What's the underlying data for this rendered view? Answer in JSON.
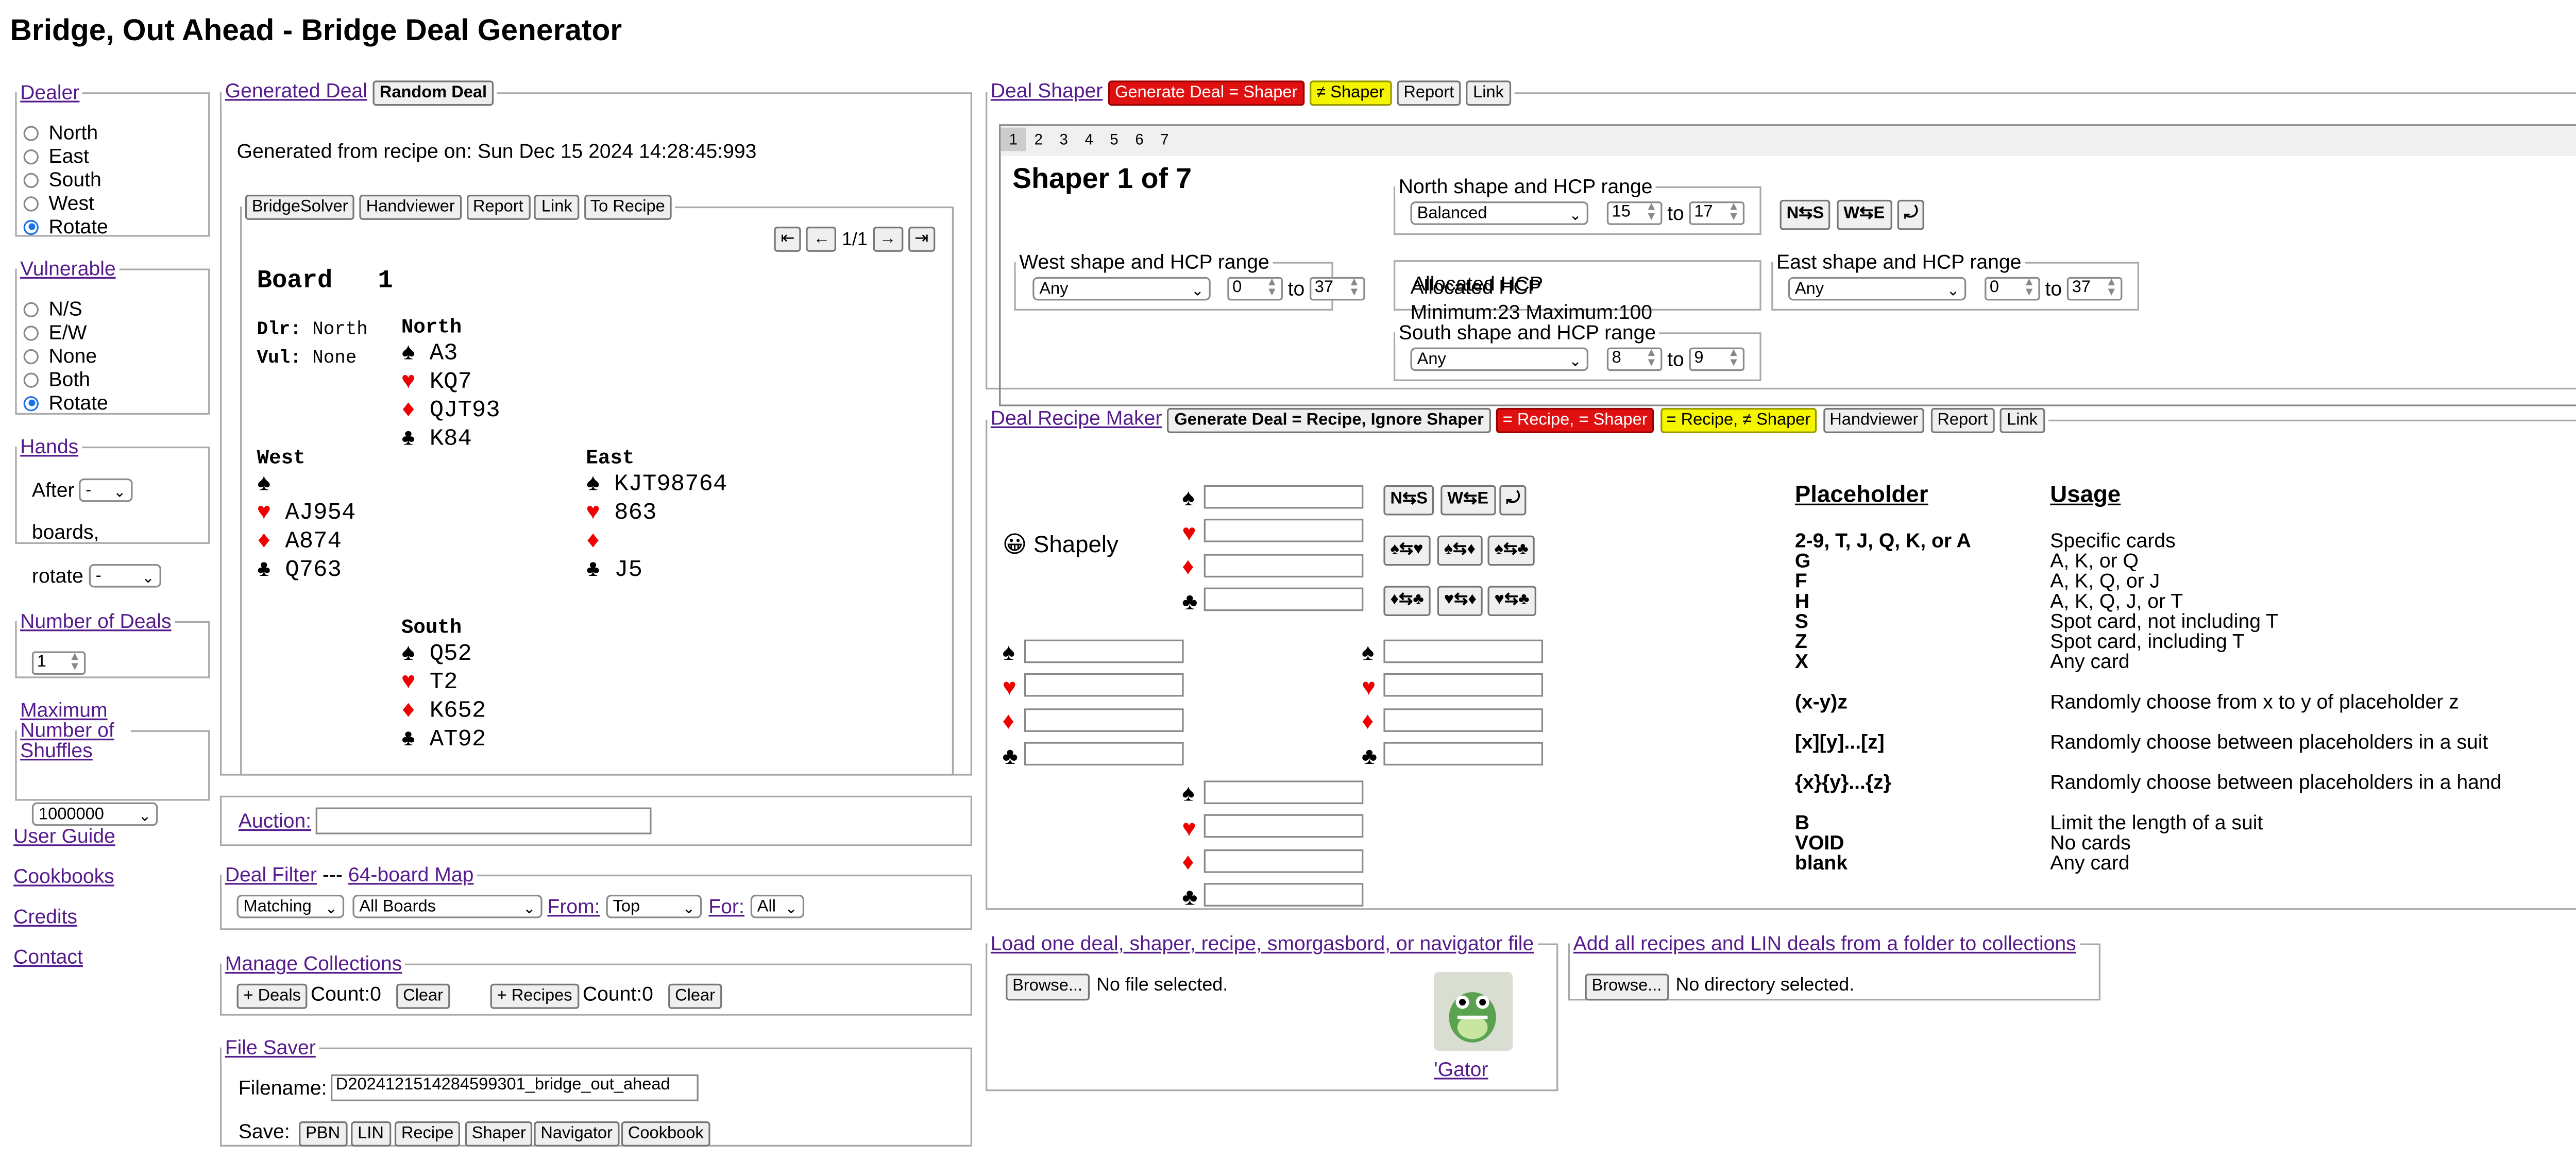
{
  "page_title": "Bridge, Out Ahead - Bridge Deal Generator",
  "dealer": {
    "legend": "Dealer",
    "options": [
      "North",
      "East",
      "South",
      "West",
      "Rotate"
    ],
    "selected": "Rotate"
  },
  "vulnerable": {
    "legend": "Vulnerable",
    "options": [
      "N/S",
      "E/W",
      "None",
      "Both",
      "Rotate"
    ],
    "selected": "Rotate"
  },
  "hands_box": {
    "legend": "Hands",
    "after_label": "After",
    "after_value": "-",
    "boards_label": "boards,",
    "rotate_label": "rotate",
    "rotate_value": "-"
  },
  "num_deals": {
    "legend": "Number of Deals",
    "value": "1"
  },
  "max_shuffles": {
    "legend": "Maximum Number of Shuffles",
    "value": "1000000"
  },
  "side_links": [
    "User Guide",
    "Cookbooks",
    "Credits",
    "Contact"
  ],
  "generated": {
    "legend": "Generated Deal",
    "random_btn": "Random Deal",
    "recipe_line": "Generated from recipe on: Sun Dec 15 2024 14:28:45:993",
    "buttons": [
      "BridgeSolver",
      "Handviewer",
      "Report",
      "Link",
      "To Recipe"
    ],
    "nav": {
      "first": "⇤",
      "prev": "←",
      "page": "1/1",
      "next": "→",
      "last": "⇥"
    },
    "board_label": "Board",
    "board_number": "1",
    "dlr_label": "Dlr:",
    "dlr_value": "North",
    "vul_label": "Vul:",
    "vul_value": "None",
    "north": {
      "name": "North",
      "s": "A3",
      "h": "KQ7",
      "d": "QJT93",
      "c": "K84"
    },
    "west": {
      "name": "West",
      "s": "",
      "h": "AJ954",
      "d": "A874",
      "c": "Q763"
    },
    "east": {
      "name": "East",
      "s": "KJT98764",
      "h": "863",
      "d": "",
      "c": "J5"
    },
    "south": {
      "name": "South",
      "s": "Q52",
      "h": "T2",
      "d": "K652",
      "c": "AT92"
    }
  },
  "auction": {
    "label": "Auction:",
    "value": ""
  },
  "deal_filter": {
    "legend": "Deal Filter",
    "sep": "---",
    "map_link": "64-board Map",
    "matching": "Matching",
    "boards": "All Boards",
    "from_label": "From:",
    "from_value": "Top",
    "for_label": "For:",
    "for_value": "All"
  },
  "collections": {
    "legend": "Manage Collections",
    "deals_btn": "+ Deals",
    "deals_count": "Count:0",
    "clear1": "Clear",
    "recipes_btn": "+ Recipes",
    "recipes_count": "Count:0",
    "clear2": "Clear"
  },
  "file_saver": {
    "legend": "File Saver",
    "filename_label": "Filename:",
    "filename_value": "D2024121514284599301_bridge_out_ahead",
    "save_label": "Save:",
    "buttons": [
      "PBN",
      "LIN",
      "Recipe",
      "Shaper",
      "Navigator",
      "Cookbook"
    ]
  },
  "shaper": {
    "legend": "Deal Shaper",
    "btn_gen": "Generate Deal = Shaper",
    "btn_ne": "≠ Shaper",
    "btn_report": "Report",
    "btn_link": "Link",
    "tabs": [
      "1",
      "2",
      "3",
      "4",
      "5",
      "6",
      "7"
    ],
    "heading": "Shaper 1 of 7",
    "north": {
      "legend": "North shape and HCP range",
      "shape": "Balanced",
      "min": "15",
      "to": "to",
      "max": "17"
    },
    "west": {
      "legend": "West shape and HCP range",
      "shape": "Any",
      "min": "0",
      "to": "to",
      "max": "37"
    },
    "east": {
      "legend": "East shape and HCP range",
      "shape": "Any",
      "min": "0",
      "to": "to",
      "max": "37"
    },
    "south": {
      "legend": "South shape and HCP range",
      "shape": "Any",
      "min": "8",
      "to": "to",
      "max": "9"
    },
    "alloc": {
      "legend": "Allocated HCP",
      "text": "Minimum:23 Maximum:100"
    },
    "swap_ns": "N⇆S",
    "swap_we": "W⇆E",
    "rotate": "⤾"
  },
  "recipe": {
    "legend": "Deal Recipe Maker",
    "btn_gen": "Generate Deal = Recipe, Ignore Shaper",
    "btn_eq_eq": "= Recipe, = Shaper",
    "btn_eq_ne": "= Recipe, ≠ Shaper",
    "btn_hv": "Handviewer",
    "btn_report": "Report",
    "btn_link": "Link",
    "shapely_emoji": "😀",
    "shapely_label": "Shapely",
    "swap_ns": "N⇆S",
    "swap_we": "W⇆E",
    "rotate": "⤾",
    "suit_swaps_1": [
      "♠⇆♥",
      "♠⇆♦",
      "♠⇆♣"
    ],
    "suit_swaps_2": [
      "♦⇆♣",
      "♥⇆♦",
      "♥⇆♣"
    ],
    "suits": [
      "♠",
      "♥",
      "♦",
      "♣"
    ],
    "placeholder_head": "Placeholder",
    "usage_head": "Usage",
    "rows": [
      {
        "p": "2-9, T, J, Q, K, or A",
        "u": "Specific cards"
      },
      {
        "p": "G",
        "u": "A, K, or Q"
      },
      {
        "p": "F",
        "u": "A, K, Q, or J"
      },
      {
        "p": "H",
        "u": "A, K, Q, J, or T"
      },
      {
        "p": "S",
        "u": "Spot card, not including T"
      },
      {
        "p": "Z",
        "u": "Spot card, including T"
      },
      {
        "p": "X",
        "u": "Any card"
      },
      {
        "p": "(x-y)z",
        "u": "Randomly choose from x to y of placeholder z"
      },
      {
        "p": "[x][y]...[z]",
        "u": "Randomly choose between placeholders in a suit"
      },
      {
        "p": "{x}{y}...{z}",
        "u": "Randomly choose between placeholders in a hand"
      },
      {
        "p": "B",
        "u": "Limit the length of a suit"
      },
      {
        "p": "VOID",
        "u": "No cards"
      },
      {
        "p": "blank",
        "u": "Any card"
      }
    ]
  },
  "load": {
    "legend": "Load one deal, shaper, recipe, smorgasbord, or navigator file",
    "browse": "Browse...",
    "status": "No file selected.",
    "gator_link": "'Gator"
  },
  "add_folder": {
    "legend": "Add all recipes and LIN deals from a folder to collections",
    "browse": "Browse...",
    "status": "No directory selected."
  }
}
